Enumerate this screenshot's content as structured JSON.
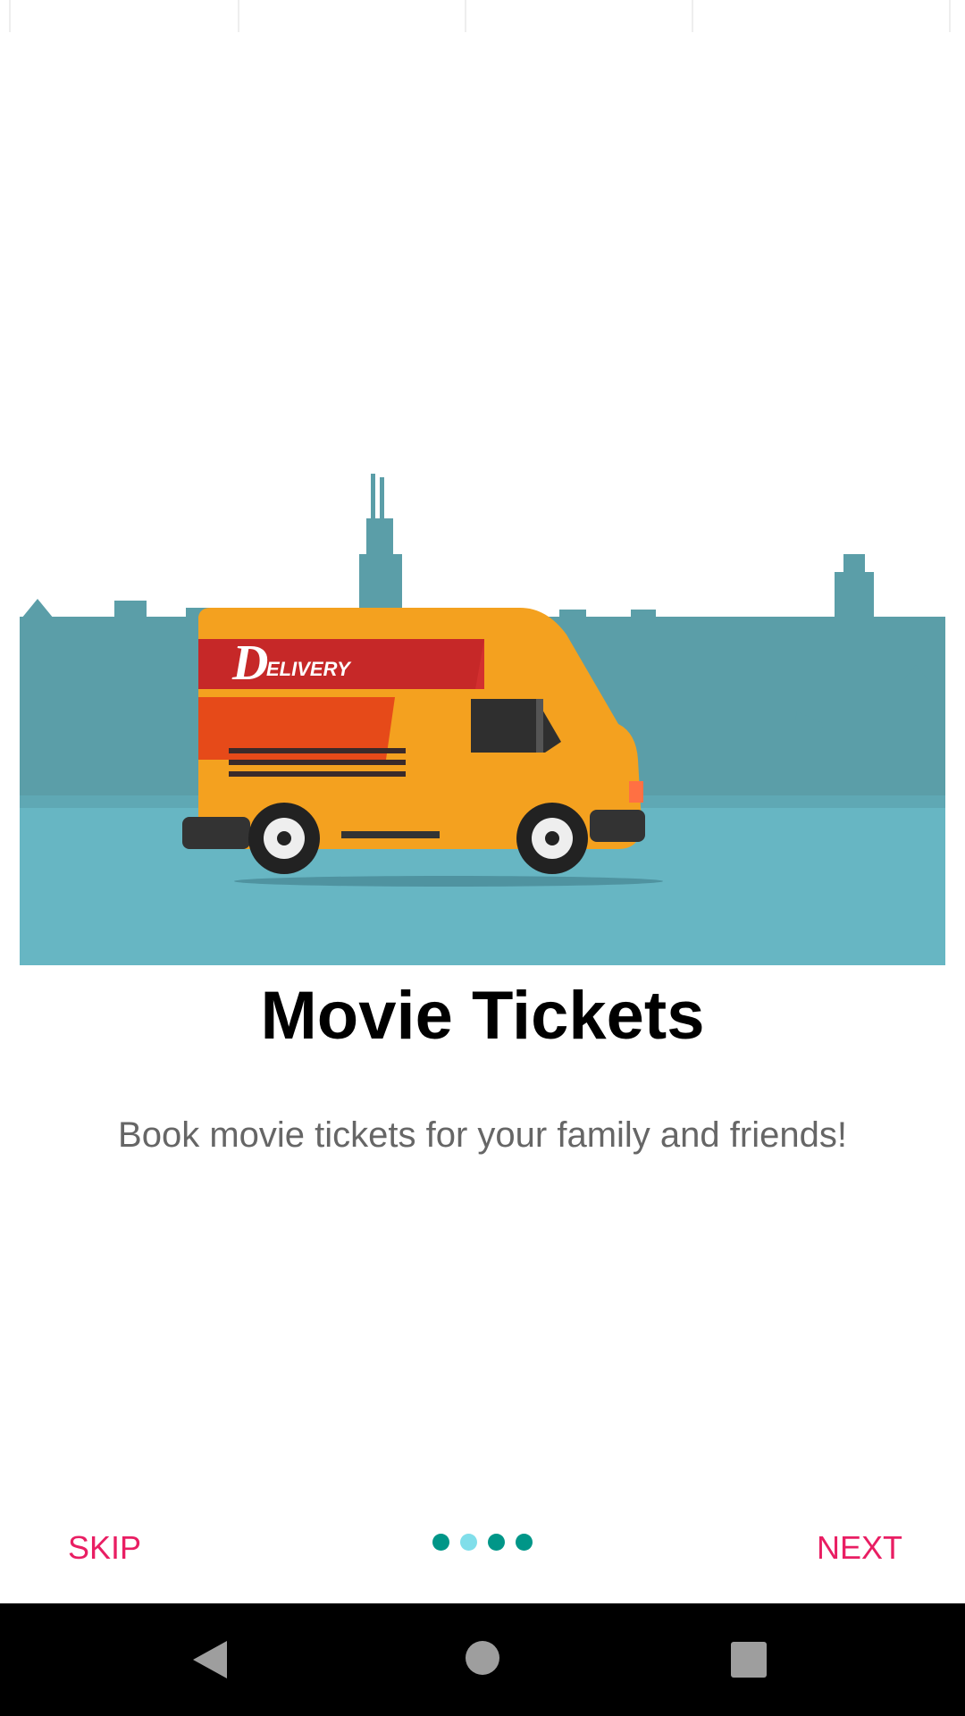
{
  "onboarding": {
    "title": "Movie Tickets",
    "subtitle": "Book movie tickets for your family and friends!",
    "illustration": {
      "van_logo_letter": "D",
      "van_logo_text": "ELIVERY"
    },
    "pager": {
      "total": 4,
      "active_index": 1,
      "colors": [
        "#009688",
        "#80DEEA",
        "#009688",
        "#009688"
      ]
    },
    "skip_label": "SKIP",
    "next_label": "NEXT"
  },
  "navigation": {
    "back_icon": "back-triangle-icon",
    "home_icon": "home-circle-icon",
    "recents_icon": "recents-square-icon"
  },
  "colors": {
    "accent": "#E91E63",
    "skyline": "#5B9EA8",
    "ground": "#67B6C3",
    "van_body": "#F4A11F",
    "van_stripe": "#D32F2F"
  }
}
